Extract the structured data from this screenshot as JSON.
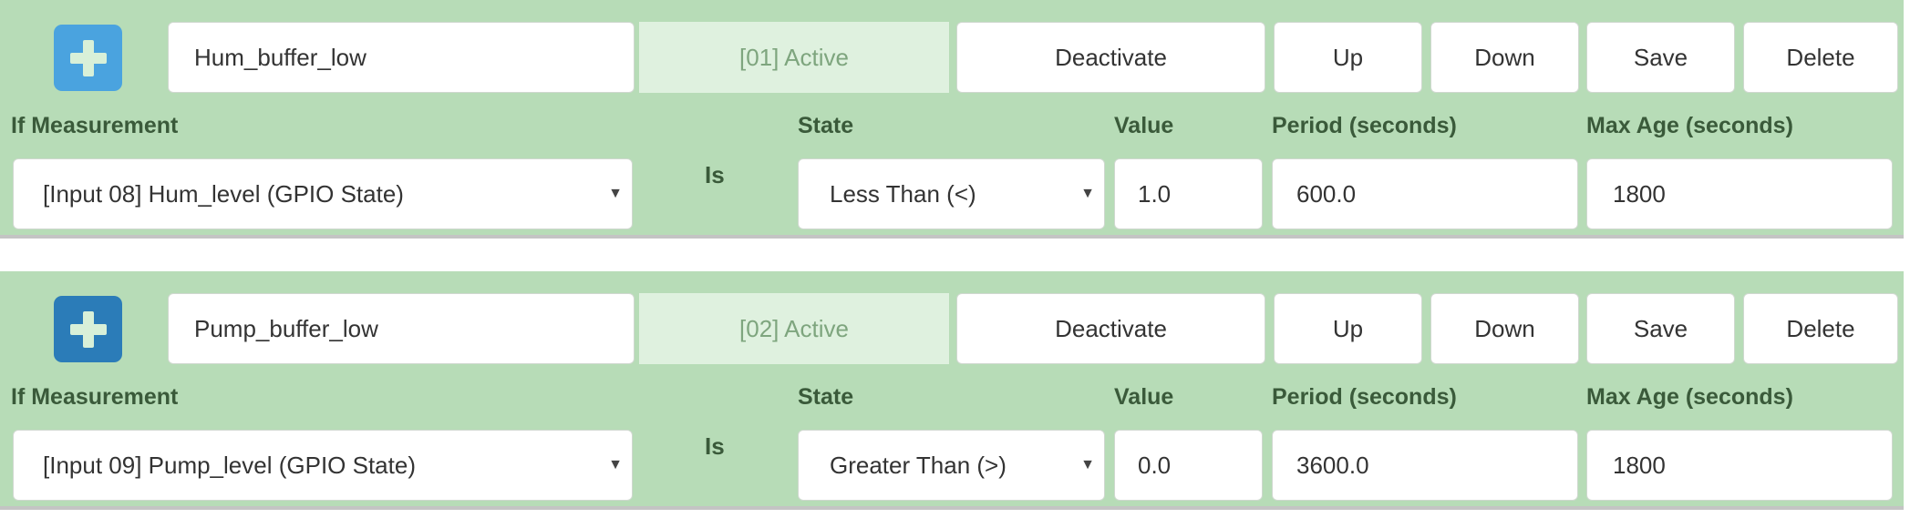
{
  "colors": {
    "panel_bg": "#b7dcb7",
    "status_bg": "#dff1df",
    "label_text": "#3a5a3a",
    "add_button_1": "#4aa3df",
    "add_button_2": "#2b7cb8"
  },
  "icons": {
    "add": "plus-icon",
    "dropdown": "caret-down-icon"
  },
  "labels": {
    "measurement": "If Measurement",
    "is": "Is",
    "state": "State",
    "value": "Value",
    "period": "Period (seconds)",
    "max_age": "Max Age (seconds)"
  },
  "buttons": {
    "deactivate": "Deactivate",
    "up": "Up",
    "down": "Down",
    "save": "Save",
    "delete": "Delete"
  },
  "conditions": [
    {
      "name": "Hum_buffer_low",
      "status": "[01] Active",
      "measurement": "[Input 08] Hum_level (GPIO State)",
      "state": "Less Than (<)",
      "value": "1.0",
      "period": "600.0",
      "max_age": "1800"
    },
    {
      "name": "Pump_buffer_low",
      "status": "[02] Active",
      "measurement": "[Input 09] Pump_level (GPIO State)",
      "state": "Greater Than (>)",
      "value": "0.0",
      "period": "3600.0",
      "max_age": "1800"
    }
  ]
}
